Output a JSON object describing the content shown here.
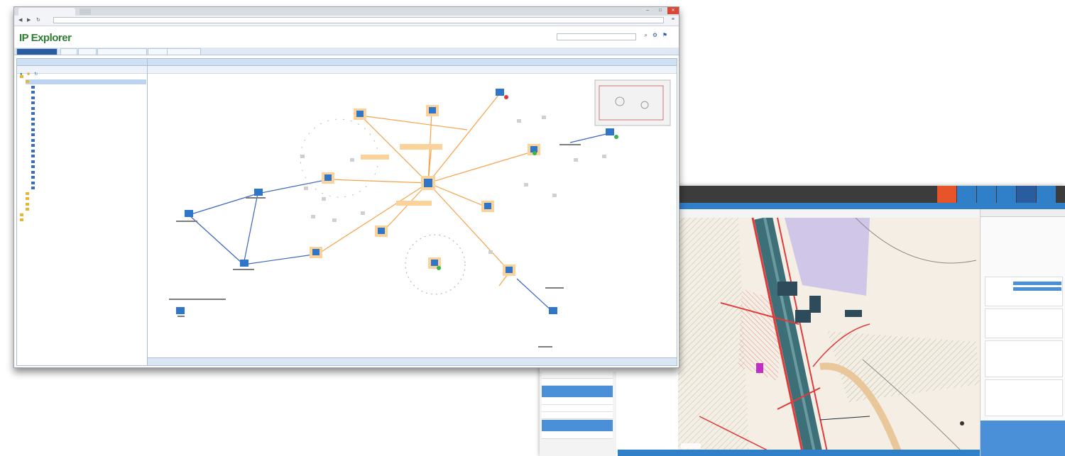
{
  "back_window": {
    "title": "",
    "subbar_text": "",
    "property_title": "",
    "scale_label": "",
    "toolbar_buttons": [
      "",
      "",
      "",
      "",
      "",
      ""
    ],
    "left_panel_items": [
      "",
      "",
      "",
      "",
      "",
      "",
      "",
      ""
    ]
  },
  "front_window": {
    "browser_tab_label": "",
    "address_bar": "",
    "logo_text": "IP Explorer",
    "tagline": "",
    "copyright": "",
    "nav_tabs": [
      "",
      "",
      "",
      "",
      "",
      "",
      ""
    ],
    "tree_panel_title": "",
    "topology_panel_title": "",
    "tree_items": [
      "",
      "",
      "",
      "",
      "",
      "",
      "",
      "",
      "",
      "",
      "",
      "",
      "",
      "",
      "",
      "",
      "",
      "",
      "",
      "",
      "",
      "",
      "",
      "",
      "",
      "",
      "",
      ""
    ],
    "device_labels": [
      ""
    ]
  },
  "colors": {
    "accent_blue": "#2f7fc9",
    "map_topbar": "#3c3c3c",
    "orange_buttons": "#e8542a",
    "logo_green": "#2e7d32",
    "link_orange": "#f5a24a",
    "link_blue": "#3a66c2"
  }
}
